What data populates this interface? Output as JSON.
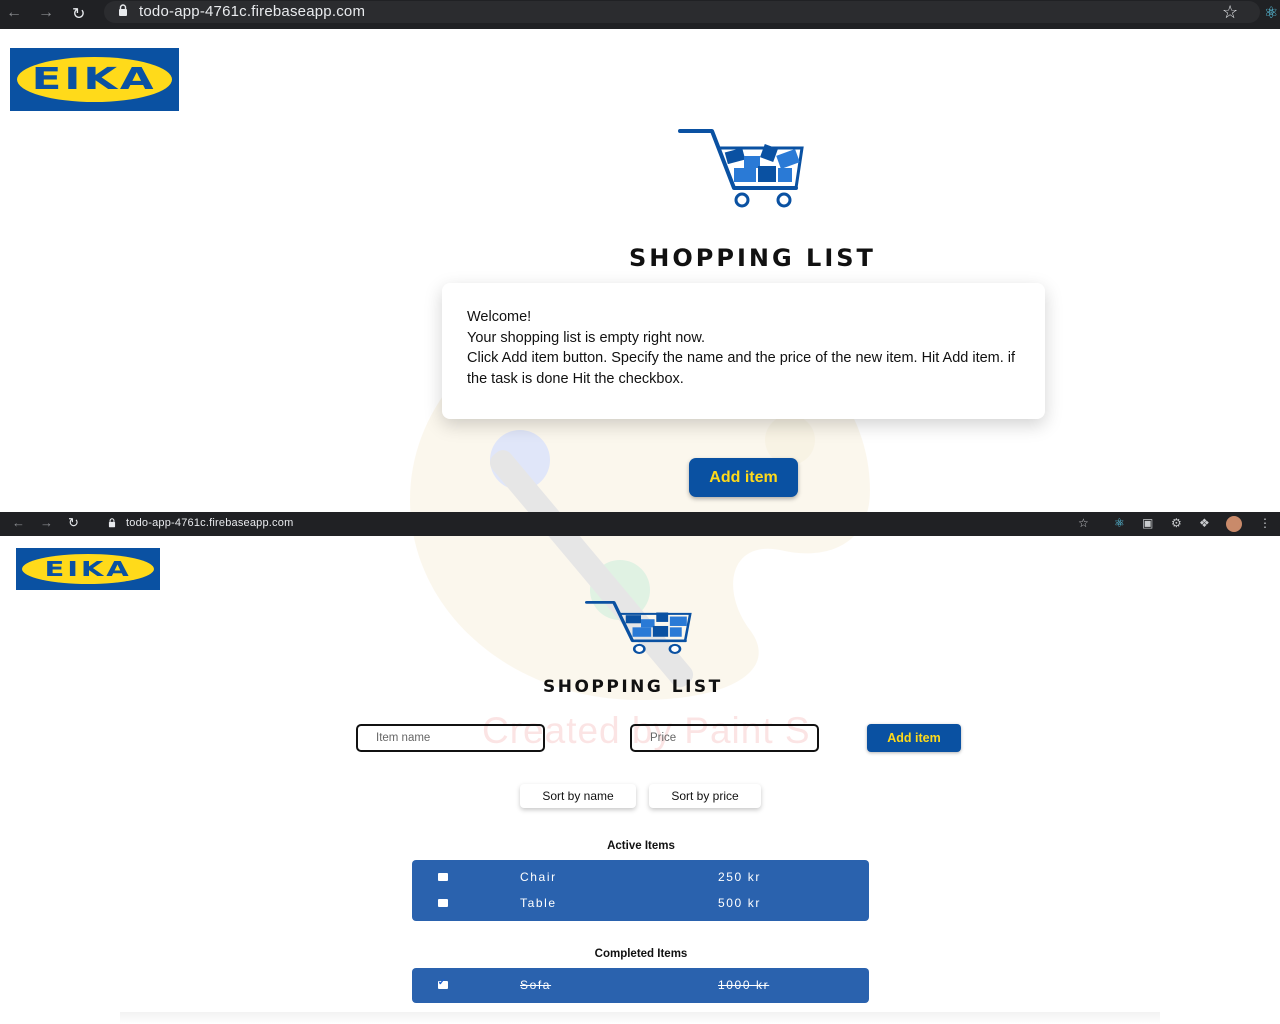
{
  "browser1": {
    "url": "todo-app-4761c.firebaseapp.com"
  },
  "browser2": {
    "url": "todo-app-4761c.firebaseapp.com"
  },
  "logo": {
    "text": "EIKA"
  },
  "title": "SHOPPING LIST",
  "welcome": {
    "line1": "Welcome!",
    "line2": "Your shopping list is empty right now.",
    "line3": "Click Add item button. Specify the name and the price of the new item. Hit Add item. if the task is done Hit the checkbox."
  },
  "add_button": "Add item",
  "form": {
    "name_placeholder": "Item name",
    "price_placeholder": "Price",
    "add_label": "Add item"
  },
  "sort": {
    "by_name": "Sort by name",
    "by_price": "Sort by price"
  },
  "active": {
    "label": "Active Items",
    "items": [
      {
        "name": "Chair",
        "price": "250 kr"
      },
      {
        "name": "Table",
        "price": "500 kr"
      }
    ]
  },
  "completed": {
    "label": "Completed Items",
    "items": [
      {
        "name": "Sofa",
        "price": "1000 kr"
      }
    ]
  },
  "watermark": "Created by Paint S",
  "colors": {
    "brand_blue": "#0a51a2",
    "brand_yellow": "#ffda1a",
    "list_blue": "#2a62ae"
  }
}
